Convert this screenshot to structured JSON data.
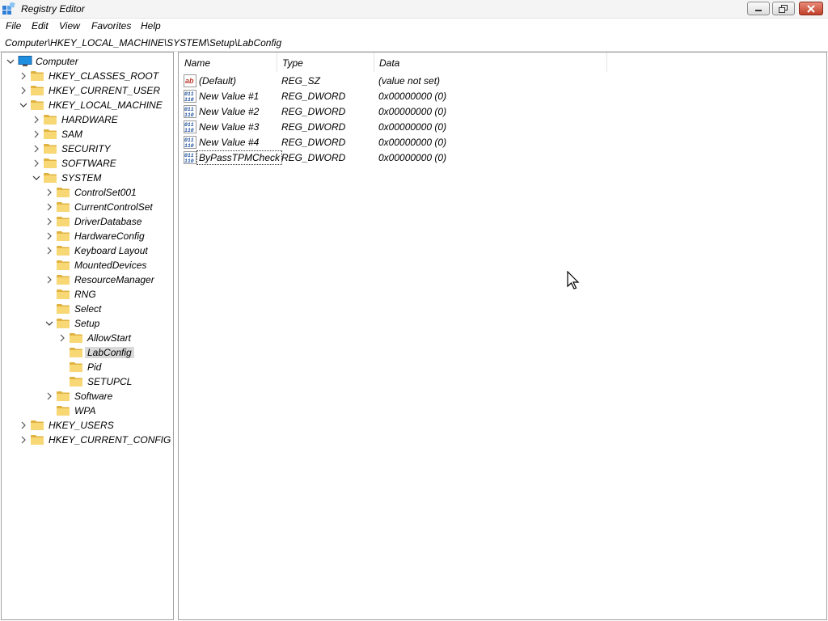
{
  "window": {
    "title": "Registry Editor",
    "app_icon": "registry-editor-icon"
  },
  "menu": [
    "File",
    "Edit",
    "View",
    "Favorites",
    "Help"
  ],
  "address": "Computer\\HKEY_LOCAL_MACHINE\\SYSTEM\\Setup\\LabConfig",
  "tree": [
    {
      "label": "Computer",
      "expanded": true,
      "icon": "computer-icon"
    },
    {
      "label": "HKEY_CLASSES_ROOT",
      "expanded": false
    },
    {
      "label": "HKEY_CURRENT_USER",
      "expanded": false
    },
    {
      "label": "HKEY_LOCAL_MACHINE",
      "expanded": true
    },
    {
      "label": "HARDWARE",
      "expanded": false
    },
    {
      "label": "SAM",
      "expanded": false
    },
    {
      "label": "SECURITY",
      "expanded": false
    },
    {
      "label": "SOFTWARE",
      "expanded": false
    },
    {
      "label": "SYSTEM",
      "expanded": true
    },
    {
      "label": "ControlSet001",
      "expanded": false
    },
    {
      "label": "CurrentControlSet",
      "expanded": false
    },
    {
      "label": "DriverDatabase",
      "expanded": false
    },
    {
      "label": "HardwareConfig",
      "expanded": false
    },
    {
      "label": "Keyboard Layout",
      "expanded": false
    },
    {
      "label": "MountedDevices",
      "expanded": null
    },
    {
      "label": "ResourceManager",
      "expanded": false
    },
    {
      "label": "RNG",
      "expanded": null
    },
    {
      "label": "Select",
      "expanded": null
    },
    {
      "label": "Setup",
      "expanded": true
    },
    {
      "label": "AllowStart",
      "expanded": false
    },
    {
      "label": "LabConfig",
      "expanded": null,
      "selected": true
    },
    {
      "label": "Pid",
      "expanded": null
    },
    {
      "label": "SETUPCL",
      "expanded": null
    },
    {
      "label": "Software",
      "expanded": false
    },
    {
      "label": "WPA",
      "expanded": null
    },
    {
      "label": "HKEY_USERS",
      "expanded": false
    },
    {
      "label": "HKEY_CURRENT_CONFIG",
      "expanded": false
    }
  ],
  "columns": {
    "name": "Name",
    "type": "Type",
    "data": "Data"
  },
  "values": [
    {
      "name": "(Default)",
      "type": "REG_SZ",
      "data": "(value not set)",
      "icon": "string-value-icon"
    },
    {
      "name": "New Value #1",
      "type": "REG_DWORD",
      "data": "0x00000000 (0)",
      "icon": "binary-value-icon"
    },
    {
      "name": "New Value #2",
      "type": "REG_DWORD",
      "data": "0x00000000 (0)",
      "icon": "binary-value-icon"
    },
    {
      "name": "New Value #3",
      "type": "REG_DWORD",
      "data": "0x00000000 (0)",
      "icon": "binary-value-icon"
    },
    {
      "name": "New Value #4",
      "type": "REG_DWORD",
      "data": "0x00000000 (0)",
      "icon": "binary-value-icon"
    },
    {
      "name": "ByPassTPMCheck",
      "type": "REG_DWORD",
      "data": "0x00000000 (0)",
      "icon": "binary-value-icon",
      "focused": true
    }
  ],
  "colors": {
    "folder": "#f8d775",
    "folder_dark": "#e0b341",
    "selected_bg": "#d9d9d9"
  }
}
